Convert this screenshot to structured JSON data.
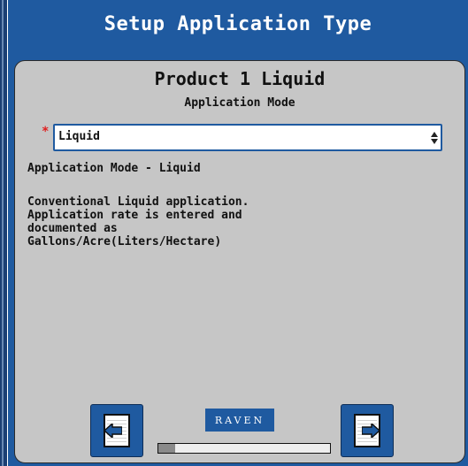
{
  "header": {
    "title": "Setup Application Type"
  },
  "panel": {
    "product_title": "Product 1 Liquid",
    "subtitle": "Application Mode",
    "required_marker": "*",
    "select": {
      "value": "Liquid"
    },
    "mode_label": "Application Mode - Liquid",
    "description_lines": [
      "Conventional Liquid application.",
      "Application rate is entered and",
      "documented as",
      "Gallons/Acre(Liters/Hectare)"
    ]
  },
  "footer": {
    "logo_text": "RAVEN",
    "back_icon": "page-back-icon",
    "next_icon": "page-next-icon",
    "progress_fraction": 0.1
  },
  "colors": {
    "header_bg": "#1f5aa0",
    "panel_bg": "#c6c6c6",
    "required": "#e02020"
  }
}
